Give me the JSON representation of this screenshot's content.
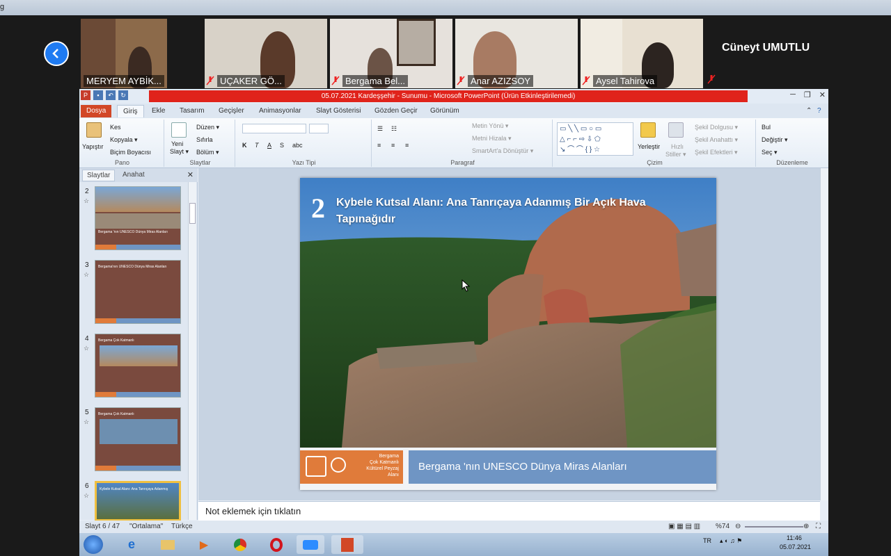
{
  "browser": {
    "corner_text": "g"
  },
  "zoom": {
    "participants": [
      {
        "name": "MERYEM AYBİK..."
      },
      {
        "name": "UÇAKER GÖ..."
      },
      {
        "name": "Bergama Bel..."
      },
      {
        "name": "Anar AZIZSOY"
      },
      {
        "name": "Aysel Tahirova"
      }
    ],
    "name_only_participant": "Cüneyt UMUTLU"
  },
  "ppt": {
    "title": "05.07.2021 Kardeşşehir - Sunumu  -  Microsoft PowerPoint (Ürün Etkinleştirilemedi)",
    "tabs": [
      "Dosya",
      "Giriş",
      "Ekle",
      "Tasarım",
      "Geçişler",
      "Animasyonlar",
      "Slayt Gösterisi",
      "Gözden Geçir",
      "Görünüm"
    ],
    "ribbon": {
      "pano": {
        "label": "Pano",
        "yapistir": "Yapıştır",
        "kes": "Kes",
        "kopyala": "Kopyala ▾",
        "bicim": "Biçim Boyacısı"
      },
      "slaytlar": {
        "label": "Slaytlar",
        "yeni": "Yeni",
        "slayt": "Slayt ▾",
        "duzen": "Düzen ▾",
        "sifirla": "Sıfırla",
        "bolum": "Bölüm ▾"
      },
      "yazitipi": {
        "label": "Yazı Tipi"
      },
      "paragraf": {
        "label": "Paragraf",
        "metin_yonu": "Metin Yönü ▾",
        "metni_hizala": "Metni Hizala ▾",
        "smartart": "SmartArt'a Dönüştür ▾"
      },
      "cizim": {
        "label": "Çizim",
        "yerlestir": "Yerleştir",
        "hizli": "Hızlı",
        "stiller": "Stiller ▾",
        "dolgu": "Şekil Dolgusu ▾",
        "anahat": "Şekil Anahattı ▾",
        "efekt": "Şekil Efektleri ▾"
      },
      "duzenleme": {
        "label": "Düzenleme",
        "bul": "Bul",
        "degistir": "Değiştir ▾",
        "sec": "Seç ▾"
      }
    },
    "pane_tabs": [
      "Slaytlar",
      "Anahat"
    ],
    "thumbs": [
      {
        "num": "2",
        "text": "Bergama 'nın UNESCO Dünya Miras Alanları"
      },
      {
        "num": "3",
        "text": "Bergama'nın UNESCO Dünya Miras Alanları"
      },
      {
        "num": "4",
        "text": "Bergama Çok Katmanlı"
      },
      {
        "num": "5",
        "text": "Bergama Çok Katmanlı"
      },
      {
        "num": "6",
        "text": "Kybele Kutsal Alanı: Ana Tanrıçaya Adanmış"
      }
    ],
    "slide": {
      "number": "2",
      "title": "Kybele Kutsal Alanı: Ana Tanrıçaya Adanmış Bir Açık Hava Tapınağıdır",
      "footer_logo_text": "Bergama\nÇok Katmanlı\nKültürel Peyzaj\nAlanı",
      "footer_banner": "Bergama 'nın UNESCO Dünya Miras Alanları"
    },
    "notes_placeholder": "Not eklemek için tıklatın",
    "status": {
      "slide": "Slayt 6 / 47",
      "theme": "\"Ortalama\"",
      "lang": "Türkçe",
      "zoom": "%74"
    }
  },
  "taskbar": {
    "lang": "TR",
    "time": "11:46",
    "date": "05.07.2021"
  }
}
